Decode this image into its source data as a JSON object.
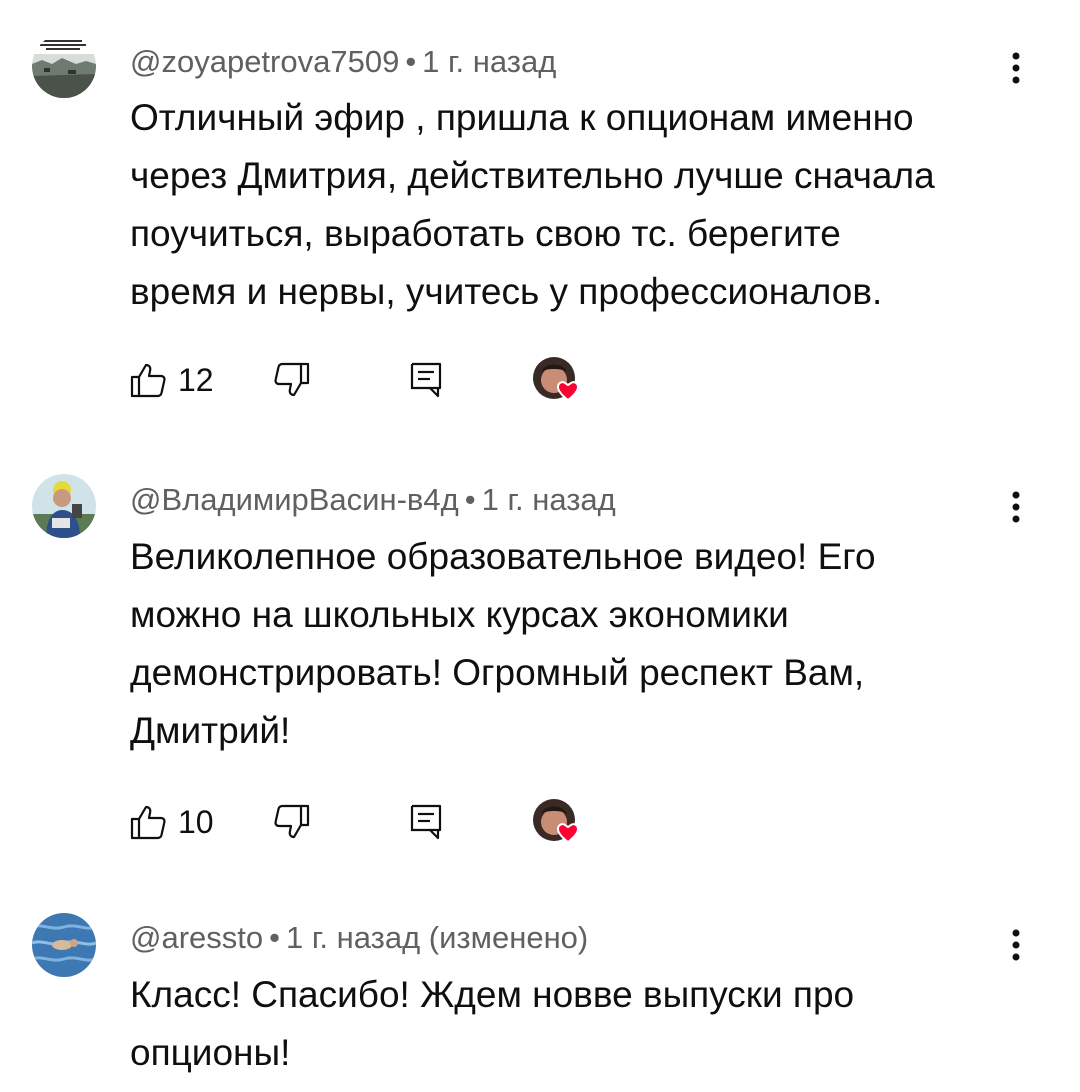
{
  "comments": [
    {
      "author": "@zoyapetrova7509",
      "time": "1 г. назад",
      "edited": "",
      "lines": [
        "Отличный эфир , пришла к опционам именно",
        "через Дмитрия, действительно лучше сначала",
        "поучиться, выработать свою тс. берегите",
        "время и нервы, учитесь у профессионалов."
      ],
      "likes": "12",
      "avatar_icon": "landscape-avatar",
      "creator_hearted": true
    },
    {
      "author": "@ВладимирВасин-в4д",
      "time": "1 г. назад",
      "edited": "",
      "lines": [
        "Великолепное образовательное видео! Его",
        "можно на школьных курсах экономики",
        "демонстрировать! Огромный респект Вам,",
        "Дмитрий!"
      ],
      "likes": "10",
      "avatar_icon": "person-avatar",
      "creator_hearted": true
    },
    {
      "author": "@aressto",
      "time": "1 г. назад",
      "edited": "(изменено)",
      "lines": [
        "Класс! Спасибо! Ждем новве выпуски про",
        "опционы!"
      ],
      "likes": "",
      "avatar_icon": "water-avatar",
      "creator_hearted": false
    }
  ],
  "separator": "•",
  "colors": {
    "text": "#0f0f0f",
    "meta": "#606060",
    "heart": "#ff0033"
  }
}
